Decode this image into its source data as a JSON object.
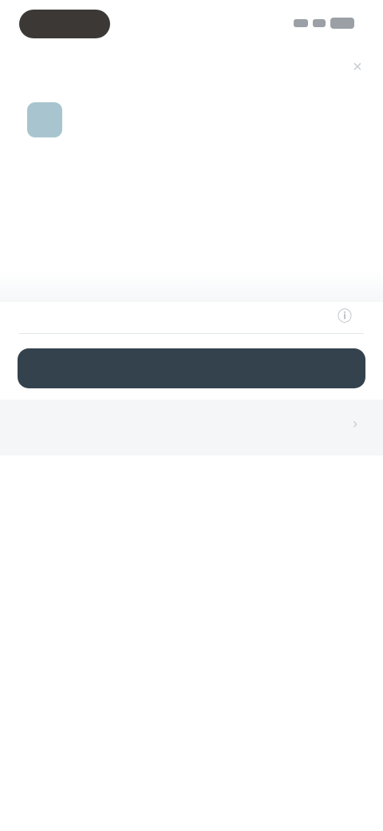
{
  "status_bar": {
    "icons": [
      "signal-icon",
      "wifi-icon",
      "battery-icon"
    ]
  },
  "header": {
    "close_icon": "close-icon",
    "link_label": ""
  },
  "card": {
    "logo_icon": "app-logo",
    "title": "",
    "description": "",
    "description_link": ""
  },
  "field": {
    "label": "",
    "icon": "info-icon"
  },
  "primary_button": {
    "label": ""
  },
  "secondary": {
    "text": "",
    "chevron_icon": "chevron-right-icon"
  },
  "colors": {
    "primary_button": "#34424d",
    "logo": "#a8c5cf",
    "title": "#3e4a52",
    "body_text": "#8596a3",
    "link": "#7aa5b8",
    "status_pill": "#3b3835"
  }
}
